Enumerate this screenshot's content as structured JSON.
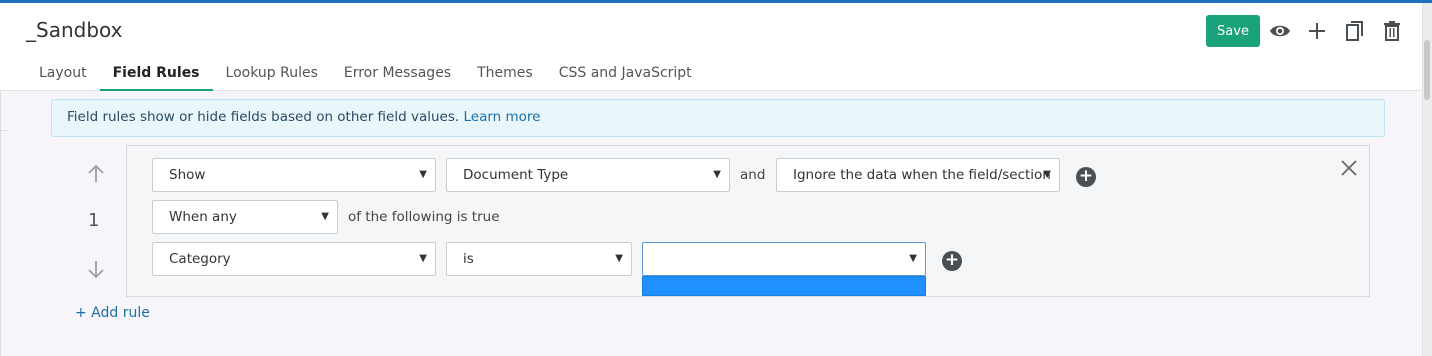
{
  "header": {
    "title": "_Sandbox",
    "save_label": "Save",
    "icons": [
      "eye-icon",
      "plus-icon",
      "copy-icon",
      "trash-icon"
    ]
  },
  "tabs": [
    {
      "label": "Layout",
      "active": false
    },
    {
      "label": "Field Rules",
      "active": true
    },
    {
      "label": "Lookup Rules",
      "active": false
    },
    {
      "label": "Error Messages",
      "active": false
    },
    {
      "label": "Themes",
      "active": false
    },
    {
      "label": "CSS and JavaScript",
      "active": false
    }
  ],
  "info": {
    "text": "Field rules show or hide fields based on other field values.",
    "link": "Learn more"
  },
  "rule": {
    "number": "1",
    "action": "Show",
    "target_field": "Document Type",
    "conjunction": "and",
    "data_option": "Ignore the data when the field/section",
    "match_mode": "When any",
    "match_suffix": "of the following is true",
    "condition": {
      "field": "Category",
      "operator": "is",
      "value": ""
    }
  },
  "add_rule_label": "+ Add rule",
  "colors": {
    "accent": "#1aa37a",
    "link": "#1b6fa8",
    "banner_bg": "#e9f7fb",
    "highlight": "#1e90ff"
  }
}
